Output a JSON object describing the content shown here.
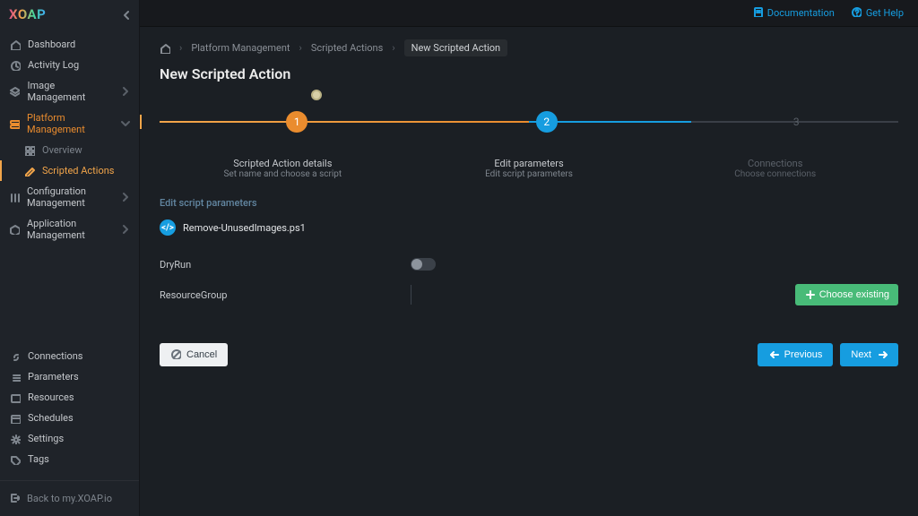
{
  "app": {
    "name": "XOAP"
  },
  "topbar": {
    "documentation": "Documentation",
    "help": "Get Help"
  },
  "sidebar": {
    "primary": [
      {
        "id": "dashboard",
        "label": "Dashboard",
        "expandable": false,
        "icon": "home"
      },
      {
        "id": "activity",
        "label": "Activity Log",
        "expandable": false,
        "icon": "clock"
      },
      {
        "id": "image",
        "label": "Image Management",
        "expandable": true,
        "icon": "layers"
      },
      {
        "id": "platform",
        "label": "Platform Management",
        "expandable": true,
        "icon": "server",
        "active": true,
        "children": [
          {
            "id": "overview",
            "label": "Overview",
            "icon": "grid"
          },
          {
            "id": "scripted",
            "label": "Scripted Actions",
            "icon": "pencil",
            "active": true
          }
        ]
      },
      {
        "id": "config",
        "label": "Configuration Management",
        "expandable": true,
        "icon": "sliders"
      },
      {
        "id": "apps",
        "label": "Application Management",
        "expandable": true,
        "icon": "package"
      }
    ],
    "secondary": [
      {
        "id": "connections",
        "label": "Connections",
        "icon": "link"
      },
      {
        "id": "parameters",
        "label": "Parameters",
        "icon": "list"
      },
      {
        "id": "resources",
        "label": "Resources",
        "icon": "box"
      },
      {
        "id": "schedules",
        "label": "Schedules",
        "icon": "calendar"
      },
      {
        "id": "settings",
        "label": "Settings",
        "icon": "gear"
      },
      {
        "id": "tags",
        "label": "Tags",
        "icon": "tag"
      }
    ],
    "back": "Back to my.XOAP.io"
  },
  "breadcrumbs": {
    "home_icon": "home",
    "items": [
      "Platform Management",
      "Scripted Actions"
    ],
    "current": "New Scripted Action"
  },
  "page": {
    "title": "New Scripted Action"
  },
  "wizard": {
    "steps": [
      {
        "num": "1",
        "title": "Scripted Action details",
        "subtitle": "Set name and choose a script",
        "state": "done"
      },
      {
        "num": "2",
        "title": "Edit parameters",
        "subtitle": "Edit script parameters",
        "state": "active"
      },
      {
        "num": "3",
        "title": "Connections",
        "subtitle": "Choose connections",
        "state": "pending"
      }
    ]
  },
  "section": {
    "heading": "Edit script parameters",
    "script_name": "Remove-UnusedImages.ps1",
    "params": {
      "dryrun_label": "DryRun",
      "dryrun_value": false,
      "resourcegroup_label": "ResourceGroup",
      "resourcegroup_value": ""
    },
    "choose_existing": "Choose existing"
  },
  "footer": {
    "cancel": "Cancel",
    "previous": "Previous",
    "next": "Next"
  },
  "colors": {
    "accent_orange": "#ea8c2e",
    "accent_blue": "#169de0",
    "accent_green": "#48bb78"
  }
}
